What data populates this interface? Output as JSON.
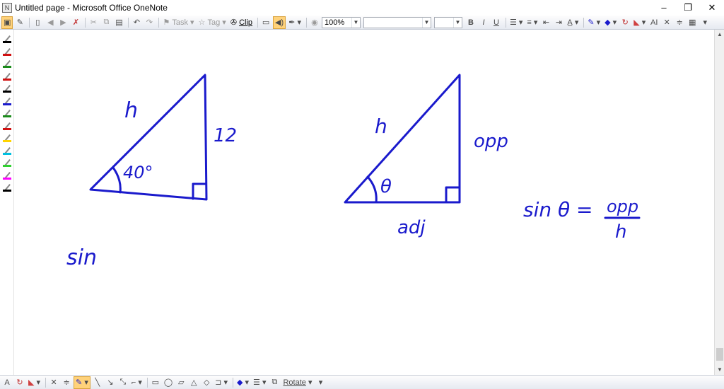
{
  "window": {
    "title": "Untitled page - Microsoft Office OneNote",
    "minimize": "–",
    "restore": "❐",
    "close": "✕"
  },
  "toolbar": {
    "task_label": "Task",
    "tag_label": "Tag",
    "clip_label": "Clip",
    "zoom_value": "100%",
    "font_name": "",
    "font_size": "",
    "bold": "B",
    "italic": "I",
    "underline": "U"
  },
  "drawbar": {
    "text_tool": "A",
    "rotate_label": "Rotate"
  },
  "ink": {
    "color": "#1a1acc",
    "left_hyp_label": "h",
    "left_side_label": "12",
    "left_angle_label": "40°",
    "sin_note": "sin",
    "right_hyp_label": "h",
    "right_opp_label": "opp",
    "right_angle_label": "θ",
    "right_adj_label": "adj",
    "formula_lhs": "sin θ =",
    "formula_num": "opp",
    "formula_den": "h"
  },
  "pens": [
    {
      "color": "#000000"
    },
    {
      "color": "#d01010"
    },
    {
      "color": "#1a8a1a"
    },
    {
      "color": "#d01010"
    },
    {
      "color": "#000000"
    },
    {
      "color": "#1a1acc"
    },
    {
      "color": "#1a8a1a"
    },
    {
      "color": "#d01010"
    },
    {
      "color": "#ffd400"
    },
    {
      "color": "#00c0e0"
    },
    {
      "color": "#30d030"
    },
    {
      "color": "#ff00ff"
    },
    {
      "color": "#000000"
    }
  ]
}
